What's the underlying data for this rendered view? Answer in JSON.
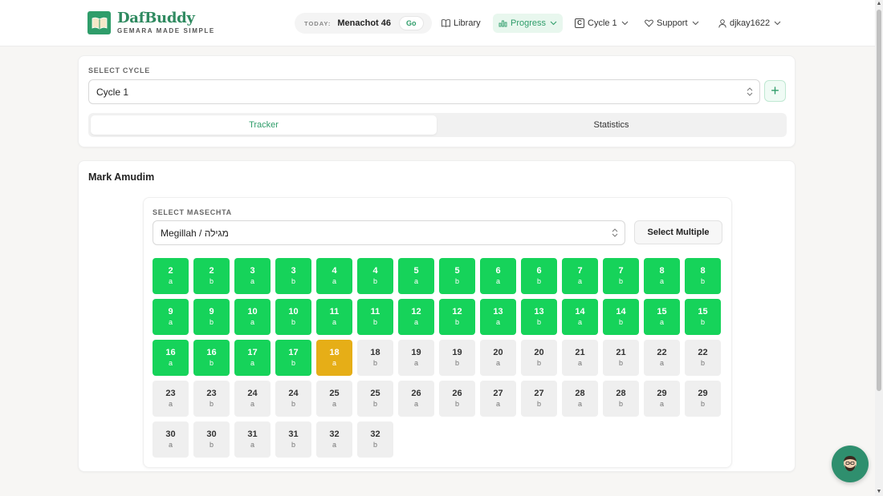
{
  "brand": {
    "name": "DafBuddy",
    "tagline": "GEMARA MADE SIMPLE",
    "color": "#2f9d6a"
  },
  "today": {
    "label": "TODAY:",
    "value": "Menachot 46",
    "go_label": "Go"
  },
  "nav": {
    "library": "Library",
    "progress": "Progress",
    "cycle_badge": "C",
    "cycle": "Cycle 1",
    "support": "Support",
    "user": "djkay1622"
  },
  "cycle_section": {
    "label": "SELECT CYCLE",
    "selected": "Cycle 1",
    "add_label": "+"
  },
  "tabs": {
    "tracker": "Tracker",
    "statistics": "Statistics",
    "active": "tracker"
  },
  "mark": {
    "title": "Mark Amudim",
    "masechta_label": "SELECT MASECHTA",
    "masechta_selected": "Megillah / מגילה",
    "select_multiple": "Select Multiple",
    "current_daf": "18a",
    "pages": [
      {
        "daf": "2",
        "amud": "a",
        "status": "done"
      },
      {
        "daf": "2",
        "amud": "b",
        "status": "done"
      },
      {
        "daf": "3",
        "amud": "a",
        "status": "done"
      },
      {
        "daf": "3",
        "amud": "b",
        "status": "done"
      },
      {
        "daf": "4",
        "amud": "a",
        "status": "done"
      },
      {
        "daf": "4",
        "amud": "b",
        "status": "done"
      },
      {
        "daf": "5",
        "amud": "a",
        "status": "done"
      },
      {
        "daf": "5",
        "amud": "b",
        "status": "done"
      },
      {
        "daf": "6",
        "amud": "a",
        "status": "done"
      },
      {
        "daf": "6",
        "amud": "b",
        "status": "done"
      },
      {
        "daf": "7",
        "amud": "a",
        "status": "done"
      },
      {
        "daf": "7",
        "amud": "b",
        "status": "done"
      },
      {
        "daf": "8",
        "amud": "a",
        "status": "done"
      },
      {
        "daf": "8",
        "amud": "b",
        "status": "done"
      },
      {
        "daf": "9",
        "amud": "a",
        "status": "done"
      },
      {
        "daf": "9",
        "amud": "b",
        "status": "done"
      },
      {
        "daf": "10",
        "amud": "a",
        "status": "done"
      },
      {
        "daf": "10",
        "amud": "b",
        "status": "done"
      },
      {
        "daf": "11",
        "amud": "a",
        "status": "done"
      },
      {
        "daf": "11",
        "amud": "b",
        "status": "done"
      },
      {
        "daf": "12",
        "amud": "a",
        "status": "done"
      },
      {
        "daf": "12",
        "amud": "b",
        "status": "done"
      },
      {
        "daf": "13",
        "amud": "a",
        "status": "done"
      },
      {
        "daf": "13",
        "amud": "b",
        "status": "done"
      },
      {
        "daf": "14",
        "amud": "a",
        "status": "done"
      },
      {
        "daf": "14",
        "amud": "b",
        "status": "done"
      },
      {
        "daf": "15",
        "amud": "a",
        "status": "done"
      },
      {
        "daf": "15",
        "amud": "b",
        "status": "done"
      },
      {
        "daf": "16",
        "amud": "a",
        "status": "done"
      },
      {
        "daf": "16",
        "amud": "b",
        "status": "done"
      },
      {
        "daf": "17",
        "amud": "a",
        "status": "done"
      },
      {
        "daf": "17",
        "amud": "b",
        "status": "done"
      },
      {
        "daf": "18",
        "amud": "a",
        "status": "current"
      },
      {
        "daf": "18",
        "amud": "b",
        "status": "todo"
      },
      {
        "daf": "19",
        "amud": "a",
        "status": "todo"
      },
      {
        "daf": "19",
        "amud": "b",
        "status": "todo"
      },
      {
        "daf": "20",
        "amud": "a",
        "status": "todo"
      },
      {
        "daf": "20",
        "amud": "b",
        "status": "todo"
      },
      {
        "daf": "21",
        "amud": "a",
        "status": "todo"
      },
      {
        "daf": "21",
        "amud": "b",
        "status": "todo"
      },
      {
        "daf": "22",
        "amud": "a",
        "status": "todo"
      },
      {
        "daf": "22",
        "amud": "b",
        "status": "todo"
      },
      {
        "daf": "23",
        "amud": "a",
        "status": "todo"
      },
      {
        "daf": "23",
        "amud": "b",
        "status": "todo"
      },
      {
        "daf": "24",
        "amud": "a",
        "status": "todo"
      },
      {
        "daf": "24",
        "amud": "b",
        "status": "todo"
      },
      {
        "daf": "25",
        "amud": "a",
        "status": "todo"
      },
      {
        "daf": "25",
        "amud": "b",
        "status": "todo"
      },
      {
        "daf": "26",
        "amud": "a",
        "status": "todo"
      },
      {
        "daf": "26",
        "amud": "b",
        "status": "todo"
      },
      {
        "daf": "27",
        "amud": "a",
        "status": "todo"
      },
      {
        "daf": "27",
        "amud": "b",
        "status": "todo"
      },
      {
        "daf": "28",
        "amud": "a",
        "status": "todo"
      },
      {
        "daf": "28",
        "amud": "b",
        "status": "todo"
      },
      {
        "daf": "29",
        "amud": "a",
        "status": "todo"
      },
      {
        "daf": "29",
        "amud": "b",
        "status": "todo"
      },
      {
        "daf": "30",
        "amud": "a",
        "status": "todo"
      },
      {
        "daf": "30",
        "amud": "b",
        "status": "todo"
      },
      {
        "daf": "31",
        "amud": "a",
        "status": "todo"
      },
      {
        "daf": "31",
        "amud": "b",
        "status": "todo"
      },
      {
        "daf": "32",
        "amud": "a",
        "status": "todo"
      },
      {
        "daf": "32",
        "amud": "b",
        "status": "todo"
      }
    ]
  },
  "colors": {
    "done": "#16d35a",
    "current": "#e6ae17",
    "todo": "#efefef",
    "accent": "#2f9d6a"
  },
  "icons": {
    "logo": "open-book-icon",
    "library": "book-icon",
    "progress": "bar-chart-icon",
    "support": "heart-icon",
    "user": "user-icon",
    "chat": "chat-avatar-icon"
  }
}
